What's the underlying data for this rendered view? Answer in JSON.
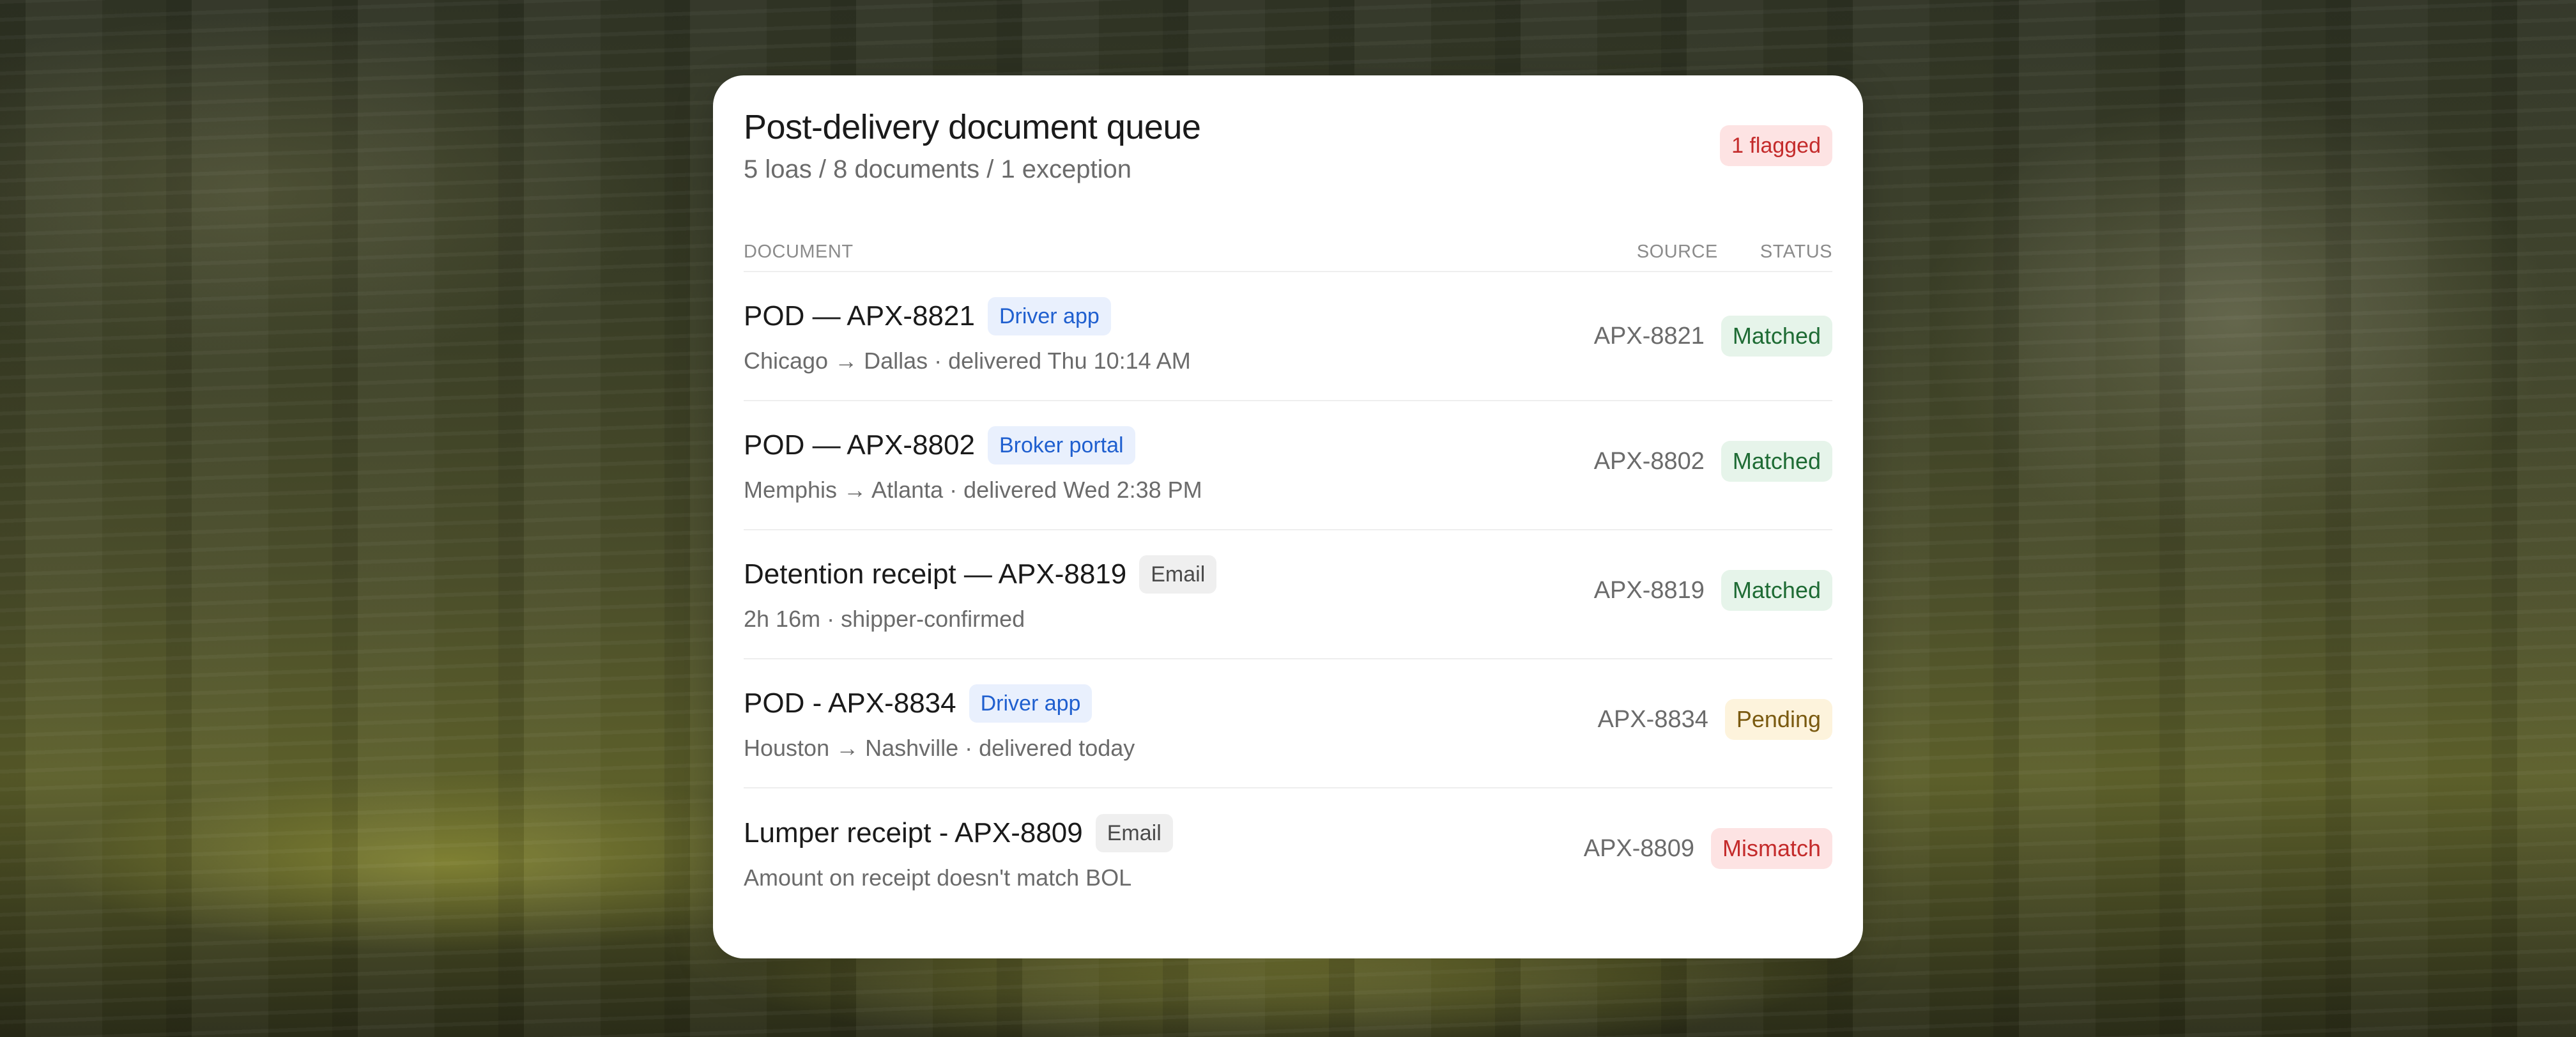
{
  "header": {
    "title": "Post-delivery document queue",
    "subtitle": "5 loas  / 8 documents / 1 exception",
    "flag_badge": "1 flagged"
  },
  "columns": {
    "document": "DOCUMENT",
    "source": "SOURCE",
    "status": "STATUS"
  },
  "rows": [
    {
      "name": "POD — APX-8821",
      "channel": "Driver app",
      "sub": "Chicago → Dallas · delivered Thu 10:14 AM",
      "source": "APX-8821",
      "status": "Matched"
    },
    {
      "name": "POD — APX-8802",
      "channel": "Broker portal",
      "sub": "Memphis → Atlanta · delivered Wed 2:38 PM",
      "source": "APX-8802",
      "status": "Matched"
    },
    {
      "name": "Detention receipt — APX-8819",
      "channel": "Email",
      "sub": "2h 16m · shipper-confirmed",
      "source": "APX-8819",
      "status": "Matched"
    },
    {
      "name": "POD - APX-8834",
      "channel": "Driver app",
      "sub": "Houston → Nashville · delivered today",
      "source": "APX-8834",
      "status": "Pending"
    },
    {
      "name": "Lumper receipt - APX-8809",
      "channel": "Email",
      "sub": "Amount on receipt doesn't match BOL",
      "source": "APX-8809",
      "status": "Mismatch"
    }
  ],
  "colors": {
    "matched": "#1e6b34",
    "pending": "#7a5a10",
    "mismatch": "#c42b2b",
    "channel_blue": "#1f5fcf"
  }
}
